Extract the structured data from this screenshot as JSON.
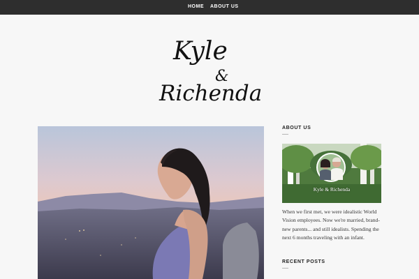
{
  "nav": {
    "items": [
      {
        "label": "HOME"
      },
      {
        "label": "ABOUT US"
      }
    ]
  },
  "logo": {
    "line1": "Kyle",
    "ampersand": "&",
    "line2": "Richenda"
  },
  "hero": {
    "icon": "hero-photo-woman-at-sunset"
  },
  "sidebar": {
    "about": {
      "title": "ABOUT US",
      "photo_caption": "Kyle & Richenda",
      "text": "When we first met, we were idealistic World Vision employees. Now we're married, brand-new parents... and still idealists. Spending the next 6 months traveling with an infant."
    },
    "recent_posts": {
      "title": "RECENT POSTS"
    }
  },
  "colors": {
    "nav_background": "#2e2e2e",
    "page_background": "#f7f7f7",
    "text": "#333333"
  }
}
